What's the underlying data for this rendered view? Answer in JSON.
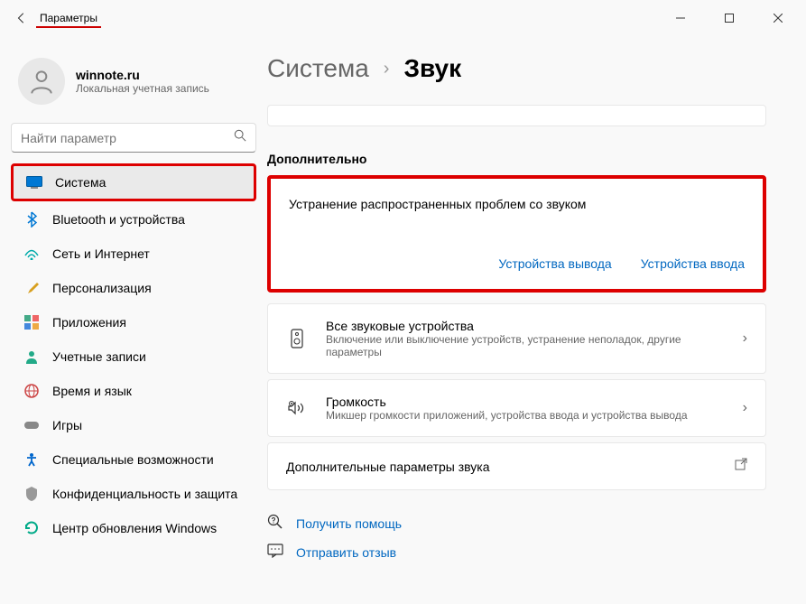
{
  "titlebar": {
    "title": "Параметры"
  },
  "profile": {
    "name": "winnote.ru",
    "subtitle": "Локальная учетная запись"
  },
  "search": {
    "placeholder": "Найти параметр"
  },
  "nav": [
    {
      "label": "Система",
      "active": true,
      "highlighted": true
    },
    {
      "label": "Bluetooth и устройства"
    },
    {
      "label": "Сеть и Интернет"
    },
    {
      "label": "Персонализация"
    },
    {
      "label": "Приложения"
    },
    {
      "label": "Учетные записи"
    },
    {
      "label": "Время и язык"
    },
    {
      "label": "Игры"
    },
    {
      "label": "Специальные возможности"
    },
    {
      "label": "Конфиденциальность и защита"
    },
    {
      "label": "Центр обновления Windows"
    }
  ],
  "breadcrumb": {
    "parent": "Система",
    "current": "Звук"
  },
  "section": {
    "title": "Дополнительно"
  },
  "troubleshoot": {
    "title": "Устранение распространенных проблем со звуком",
    "link_output": "Устройства вывода",
    "link_input": "Устройства ввода"
  },
  "cards": {
    "devices": {
      "title": "Все звуковые устройства",
      "desc": "Включение или выключение устройств, устранение неполадок, другие параметры"
    },
    "volume": {
      "title": "Громкость",
      "desc": "Микшер громкости приложений, устройства ввода и устройства вывода"
    },
    "more": {
      "title": "Дополнительные параметры звука"
    }
  },
  "help": {
    "get_help": "Получить помощь",
    "feedback": "Отправить отзыв"
  }
}
